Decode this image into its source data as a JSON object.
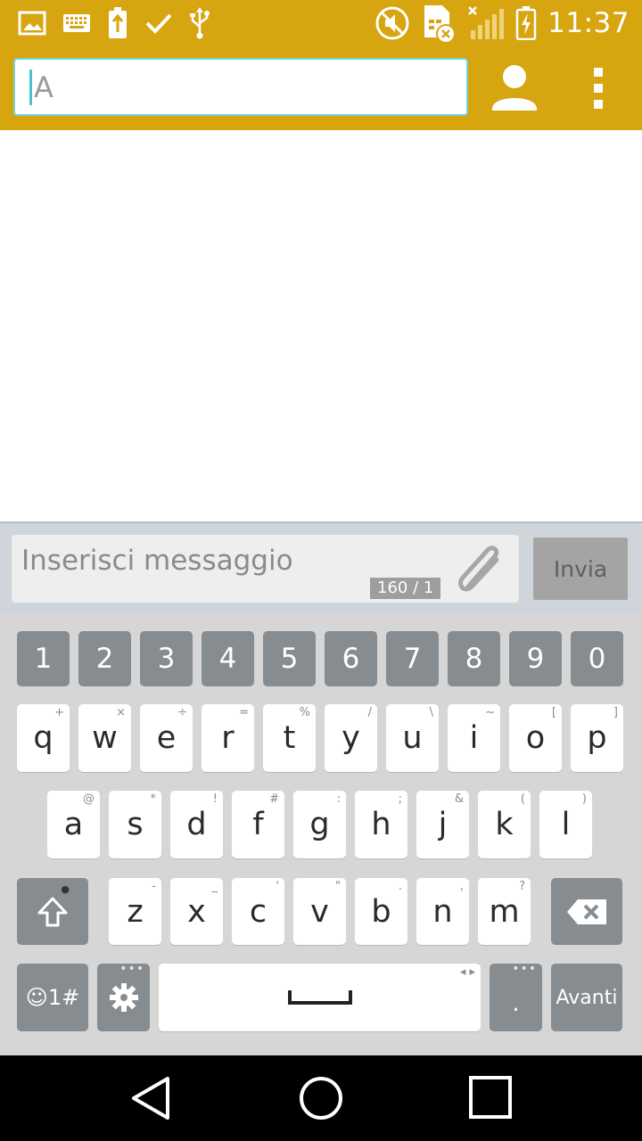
{
  "statusbar": {
    "left_icons": [
      "image-icon",
      "keyboard-icon",
      "battery-saver-icon",
      "check-icon",
      "usb-icon"
    ],
    "right_icons": [
      "mute-icon",
      "sim-error-icon",
      "signal-icon",
      "battery-charging-icon"
    ],
    "time": "11:37"
  },
  "appbar": {
    "to_value": "A"
  },
  "compose": {
    "placeholder": "Inserisci messaggio",
    "counter": "160 / 1",
    "send_label": "Invia"
  },
  "keyboard": {
    "number_row": [
      "1",
      "2",
      "3",
      "4",
      "5",
      "6",
      "7",
      "8",
      "9",
      "0"
    ],
    "row1": [
      {
        "label": "q",
        "hint": "+"
      },
      {
        "label": "w",
        "hint": "×"
      },
      {
        "label": "e",
        "hint": "÷"
      },
      {
        "label": "r",
        "hint": "="
      },
      {
        "label": "t",
        "hint": "%"
      },
      {
        "label": "y",
        "hint": "/"
      },
      {
        "label": "u",
        "hint": "\\"
      },
      {
        "label": "i",
        "hint": "~"
      },
      {
        "label": "o",
        "hint": "["
      },
      {
        "label": "p",
        "hint": "]"
      }
    ],
    "row2": [
      {
        "label": "a",
        "hint": "@"
      },
      {
        "label": "s",
        "hint": "*"
      },
      {
        "label": "d",
        "hint": "!"
      },
      {
        "label": "f",
        "hint": "#"
      },
      {
        "label": "g",
        "hint": ":"
      },
      {
        "label": "h",
        "hint": ";"
      },
      {
        "label": "j",
        "hint": "&"
      },
      {
        "label": "k",
        "hint": "("
      },
      {
        "label": "l",
        "hint": ")"
      }
    ],
    "row3": [
      {
        "label": "z",
        "hint": "-"
      },
      {
        "label": "x",
        "hint": "_"
      },
      {
        "label": "c",
        "hint": "'"
      },
      {
        "label": "v",
        "hint": "\""
      },
      {
        "label": "b",
        "hint": "."
      },
      {
        "label": "n",
        "hint": ","
      },
      {
        "label": "m",
        "hint": "?"
      }
    ],
    "symbols_label": "☺1#",
    "period_label": ".",
    "enter_label": "Avanti"
  }
}
